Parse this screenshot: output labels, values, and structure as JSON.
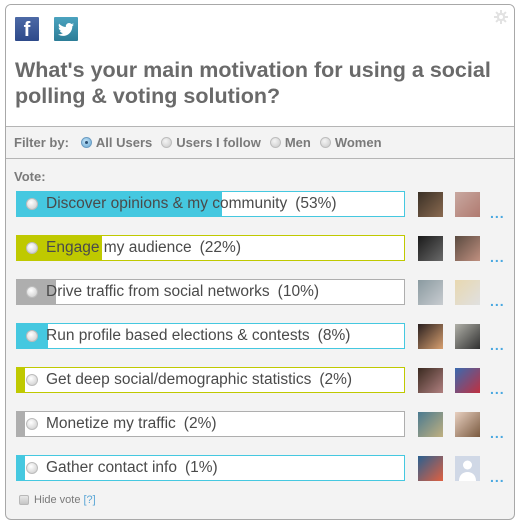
{
  "header": {
    "share": [
      {
        "name": "facebook",
        "icon": "facebook-icon",
        "glyph": "f"
      },
      {
        "name": "twitter",
        "icon": "twitter-icon",
        "glyph": "🐦"
      }
    ],
    "question": "What's your main motivation for using a social polling & voting solution?",
    "settings_icon": "gear-icon"
  },
  "filter": {
    "label": "Filter by:",
    "options": [
      {
        "label": "All Users",
        "selected": true
      },
      {
        "label": "Users I follow",
        "selected": false
      },
      {
        "label": "Men",
        "selected": false
      },
      {
        "label": "Women",
        "selected": false
      }
    ]
  },
  "vote": {
    "label": "Vote:",
    "options": [
      {
        "text": "Discover opinions & my community",
        "percent_label": "(53%)",
        "percent": 53,
        "color": "#45c8e0",
        "avatars": [
          {
            "desc": "user-photo"
          },
          {
            "desc": "user-photo"
          }
        ],
        "more": "..."
      },
      {
        "text": "Engage my audience",
        "percent_label": "(22%)",
        "percent": 22,
        "color": "#bfc900",
        "avatars": [
          {
            "desc": "user-photo"
          },
          {
            "desc": "user-photo"
          }
        ],
        "more": "..."
      },
      {
        "text": "Drive traffic from social networks",
        "percent_label": "(10%)",
        "percent": 10,
        "color": "#aeaeae",
        "avatars": [
          {
            "desc": "user-photo"
          },
          {
            "desc": "user-photo"
          }
        ],
        "more": "..."
      },
      {
        "text": "Run profile based elections & contests",
        "percent_label": "(8%)",
        "percent": 8,
        "color": "#45c8e0",
        "avatars": [
          {
            "desc": "user-photo"
          },
          {
            "desc": "user-photo"
          }
        ],
        "more": "..."
      },
      {
        "text": "Get deep social/demographic statistics",
        "percent_label": "(2%)",
        "percent": 2,
        "color": "#bfc900",
        "avatars": [
          {
            "desc": "user-photo"
          },
          {
            "desc": "user-photo"
          }
        ],
        "more": "..."
      },
      {
        "text": "Monetize my traffic",
        "percent_label": "(2%)",
        "percent": 2,
        "color": "#aeaeae",
        "avatars": [
          {
            "desc": "user-photo"
          },
          {
            "desc": "user-photo"
          }
        ],
        "more": "..."
      },
      {
        "text": "Gather contact info",
        "percent_label": "(1%)",
        "percent": 1,
        "color": "#45c8e0",
        "avatars": [
          {
            "desc": "user-photo"
          },
          {
            "desc": "default-avatar"
          }
        ],
        "more": "..."
      }
    ]
  },
  "footer": {
    "hide_vote_label": "Hide vote",
    "help_label": "[?]"
  }
}
